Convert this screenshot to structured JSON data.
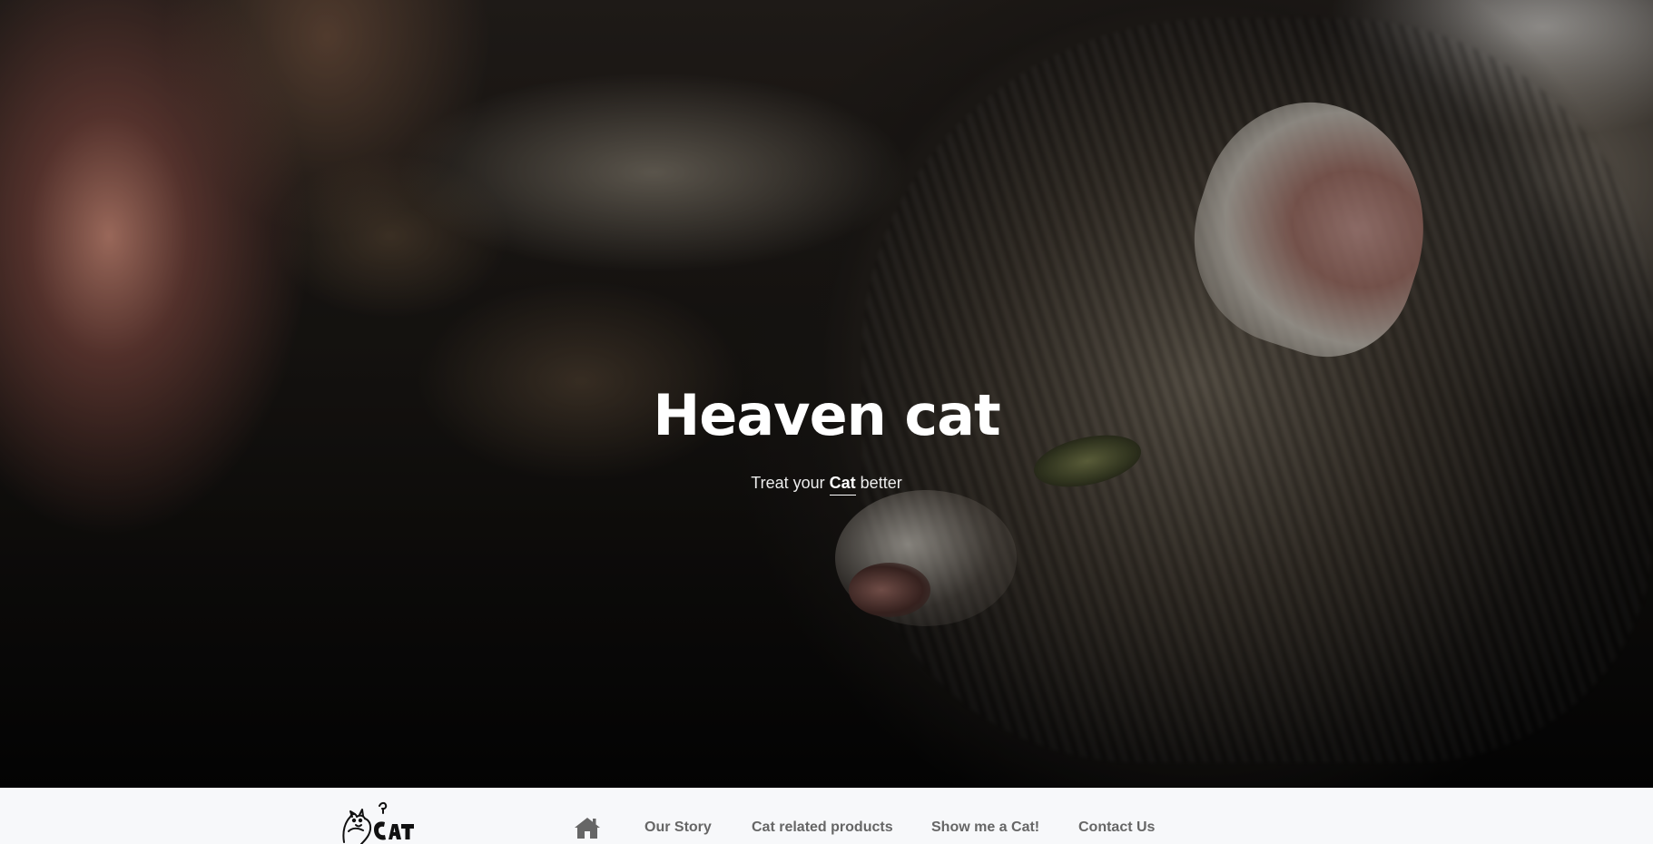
{
  "hero": {
    "title": "Heaven cat",
    "tagline_before": "Treat your ",
    "tagline_highlight": "Cat",
    "tagline_after": " better"
  },
  "navbar": {
    "logo_icon": "cat-logo-icon",
    "home_icon": "home-icon",
    "links": [
      "Our Story",
      "Cat related products",
      "Show me a Cat!",
      "Contact Us"
    ]
  },
  "colors": {
    "navbar_bg": "#f7f8fa",
    "nav_text": "#666666",
    "hero_text": "#ffffff"
  }
}
